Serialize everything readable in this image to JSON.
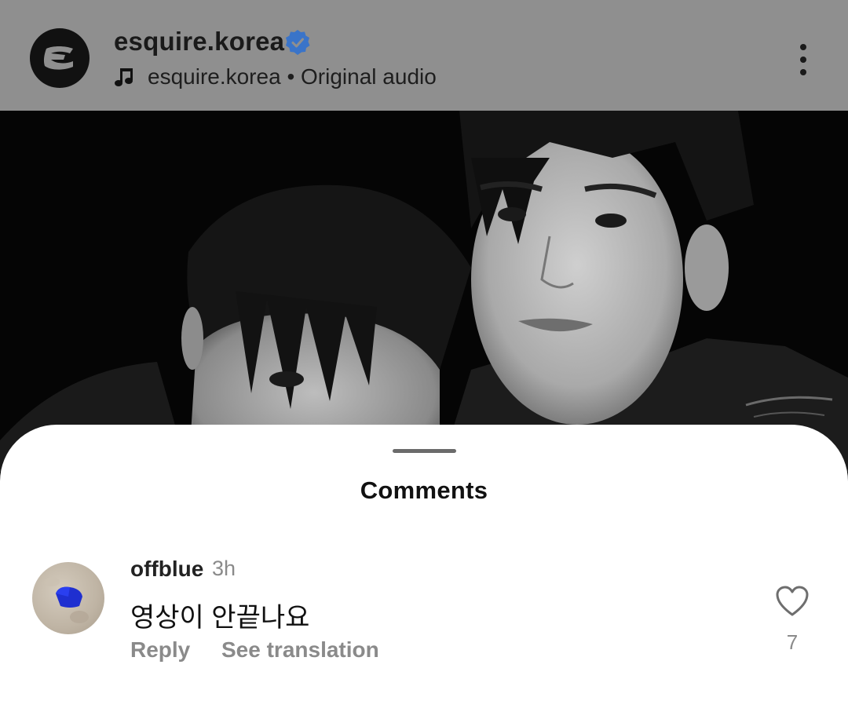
{
  "header": {
    "account_name": "esquire.korea",
    "audio_account": "esquire.korea",
    "audio_separator": "•",
    "audio_label": "Original audio",
    "icons": {
      "avatar": "esquire-logo-icon",
      "verified": "verified-badge-icon",
      "music": "music-note-icon",
      "more": "more-vertical-icon"
    },
    "colors": {
      "verified": "#3a74c9"
    }
  },
  "photo": {
    "style": "black-and-white portrait"
  },
  "comments_sheet": {
    "title": "Comments",
    "comments": [
      {
        "username": "offblue",
        "time": "3h",
        "text": "영상이 안끝나요",
        "reply_label": "Reply",
        "translate_label": "See translation",
        "like_count": "7",
        "like_icon": "heart-outline-icon"
      }
    ]
  }
}
